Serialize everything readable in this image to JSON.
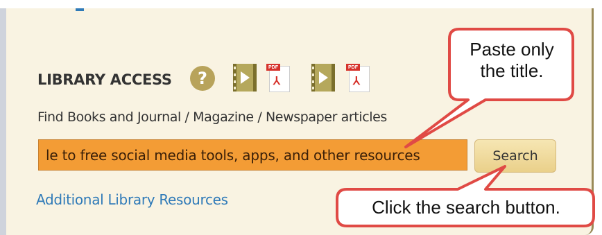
{
  "library": {
    "title": "LIBRARY ACCESS",
    "help_symbol": "?",
    "description": "Find Books and Journal / Magazine / Newspaper articles",
    "search_value": "le to free social media tools, apps, and other resources",
    "search_button": "Search",
    "additional_link": "Additional Library Resources",
    "icons": [
      "help-icon",
      "video-icon",
      "pdf-icon",
      "video-icon",
      "pdf-icon"
    ]
  },
  "annotations": {
    "paste_line1": "Paste only",
    "paste_line2": "the title.",
    "click": "Click the search button."
  },
  "colors": {
    "panel_bg": "#f9f3e2",
    "input_bg": "#f39c35",
    "button_bg": "#ead08a",
    "link": "#2f7ab8",
    "callout_border": "#e04a45"
  }
}
